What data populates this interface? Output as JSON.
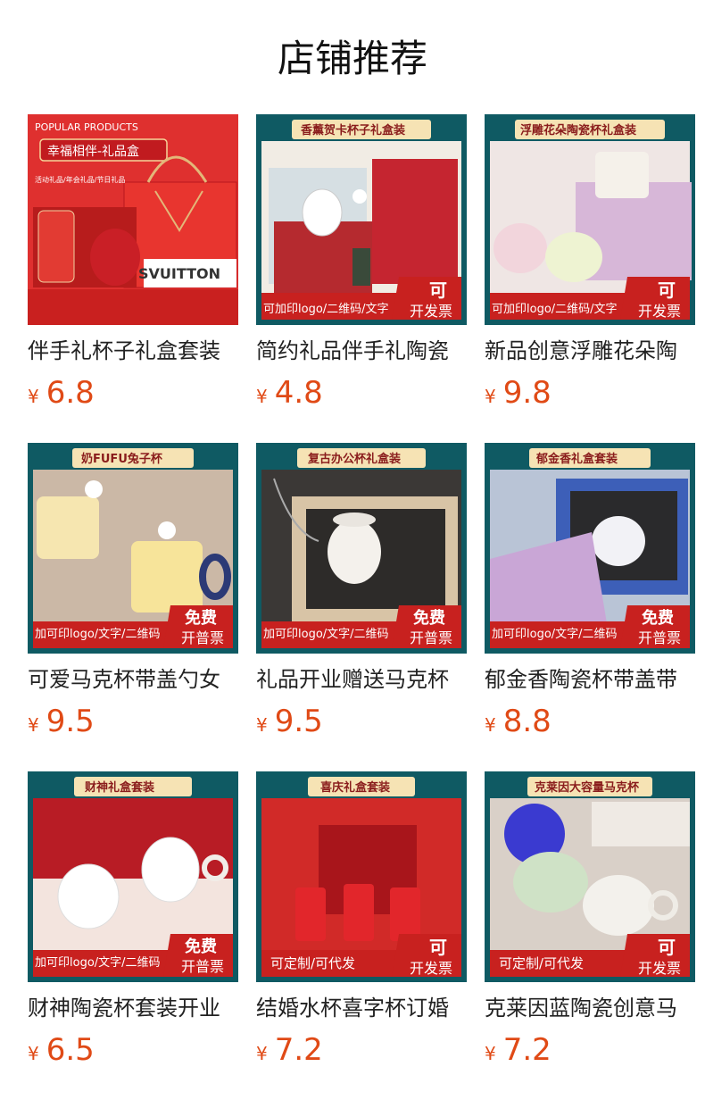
{
  "page": {
    "title": "店铺推荐"
  },
  "currency_symbol": "¥",
  "products": [
    {
      "title": "伴手礼杯子礼盒套装",
      "price": "6.8",
      "badge": {
        "header": "POPULAR PRODUCTS",
        "ribbon": "幸福相伴-礼品盒",
        "sub": "活动礼品/年会礼品/节日礼品",
        "box_text": "SVUITTON"
      }
    },
    {
      "title": "简约礼品伴手礼陶瓷",
      "price": "4.8",
      "badge": {
        "header": "香薰贺卡杯子礼盒装",
        "bar": "可加印logo/二维码/文字",
        "stamp_top": "可",
        "stamp_bottom": "开发票"
      }
    },
    {
      "title": "新品创意浮雕花朵陶",
      "price": "9.8",
      "badge": {
        "header": "浮雕花朵陶瓷杯礼盒装",
        "bar": "可加印logo/二维码/文字",
        "stamp_top": "可",
        "stamp_bottom": "开发票"
      }
    },
    {
      "title": "可爱马克杯带盖勺女",
      "price": "9.5",
      "badge": {
        "header": "奶FUFU兔子杯",
        "bar": "加可印logo/文字/二维码",
        "stamp_top": "免费",
        "stamp_bottom": "开普票"
      }
    },
    {
      "title": "礼品开业赠送马克杯",
      "price": "9.5",
      "badge": {
        "header": "复古办公杯礼盒装",
        "bar": "加可印logo/文字/二维码",
        "stamp_top": "免费",
        "stamp_bottom": "开普票"
      }
    },
    {
      "title": "郁金香陶瓷杯带盖带",
      "price": "8.8",
      "badge": {
        "header": "郁金香礼盒套装",
        "bar": "加可印logo/文字/二维码",
        "stamp_top": "免费",
        "stamp_bottom": "开普票"
      }
    },
    {
      "title": "财神陶瓷杯套装开业",
      "price": "6.5",
      "badge": {
        "header": "财神礼盒套装",
        "bar": "加可印logo/文字/二维码",
        "stamp_top": "免费",
        "stamp_bottom": "开普票"
      }
    },
    {
      "title": "结婚水杯喜字杯订婚",
      "price": "7.2",
      "badge": {
        "header": "喜庆礼盒套装",
        "bar": "可定制/可代发",
        "stamp_top": "可",
        "stamp_bottom": "开发票"
      }
    },
    {
      "title": "克莱因蓝陶瓷创意马",
      "price": "7.2",
      "badge": {
        "header": "克莱因大容量马克杯",
        "bar": "可定制/可代发",
        "stamp_top": "可",
        "stamp_bottom": "开发票"
      }
    }
  ],
  "colors": {
    "price": "#e04a16",
    "badge_red": "#c8211f",
    "badge_teal": "#0f5a63",
    "gold": "#e8c98a"
  }
}
